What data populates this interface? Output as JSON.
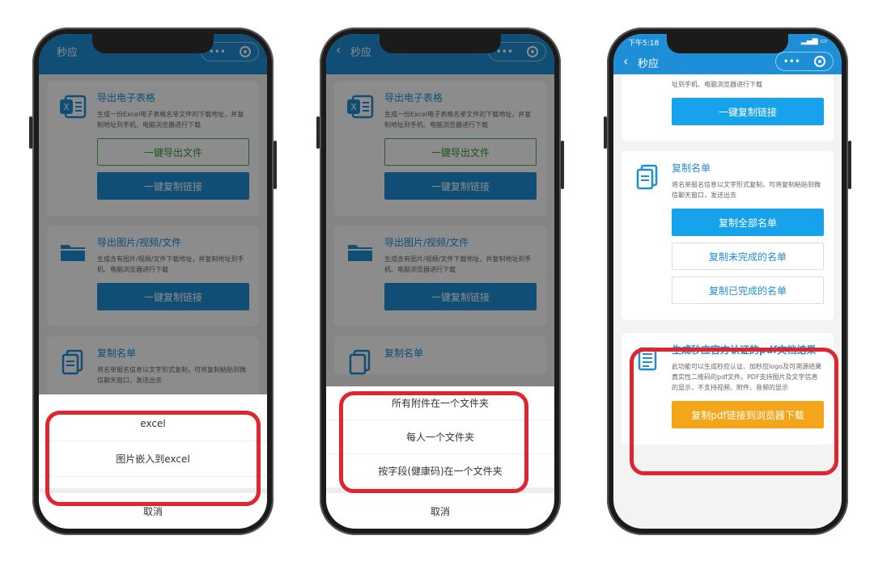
{
  "app": {
    "title": "秒应",
    "status_time": "下午5:18"
  },
  "phone1": {
    "cards": [
      {
        "title": "导出电子表格",
        "desc": "生成一份Excel电子表格名单文件的下载地址，并复制地址到手机、电脑浏览器进行下载",
        "buttons": [
          "一键导出文件",
          "一键复制链接"
        ]
      },
      {
        "title": "导出图片/视频/文件",
        "desc": "生成含有图片/视频/文件下载地址，并复制地址到手机、电脑浏览器进行下载",
        "buttons": [
          "一键复制链接"
        ]
      },
      {
        "title": "复制名单",
        "desc": "将名单报名信息以文字形式复制，可将复制粘贴到微信聊天窗口，发送出去"
      }
    ],
    "sheet": {
      "items": [
        "excel",
        "图片嵌入到excel"
      ],
      "cancel": "取消"
    }
  },
  "phone2": {
    "cards": [
      {
        "title": "导出电子表格",
        "desc": "生成一份Excel电子表格名单文件的下载地址，并复制地址到手机、电脑浏览器进行下载",
        "buttons": [
          "一键导出文件",
          "一键复制链接"
        ]
      },
      {
        "title": "导出图片/视频/文件",
        "desc": "生成含有图片/视频/文件下载地址，并复制地址到手机、电脑浏览器进行下载",
        "buttons": [
          "一键复制链接"
        ]
      },
      {
        "title": "复制名单"
      }
    ],
    "sheet": {
      "items": [
        "所有附件在一个文件夹",
        "每人一个文件夹",
        "按字段(健康码)在一个文件夹"
      ],
      "cancel": "取消"
    }
  },
  "phone3": {
    "top_desc": "址到手机、电脑浏览器进行下载",
    "top_button": "一键复制链接",
    "copy_card": {
      "title": "复制名单",
      "desc": "将名单报名信息以文字形式复制，可将复制粘贴到微信聊天窗口，发送出去",
      "buttons": [
        "复制全部名单",
        "复制未完成的名单",
        "复制已完成的名单"
      ]
    },
    "pdf_card": {
      "title": "生成秒应官方认证的pdf文档结果",
      "desc": "此功能可以生成秒应认证、加秒应logo及可溯源结果真实性二维码的pdf文件。PDF支持图片及文字信息的显示，不支持视频、附件、音频的显示",
      "button": "复制pdf链接到浏览器下载"
    }
  },
  "colors": {
    "brand": "#1e8fd6",
    "highlight": "#e0252f",
    "orange": "#f4a61a"
  }
}
